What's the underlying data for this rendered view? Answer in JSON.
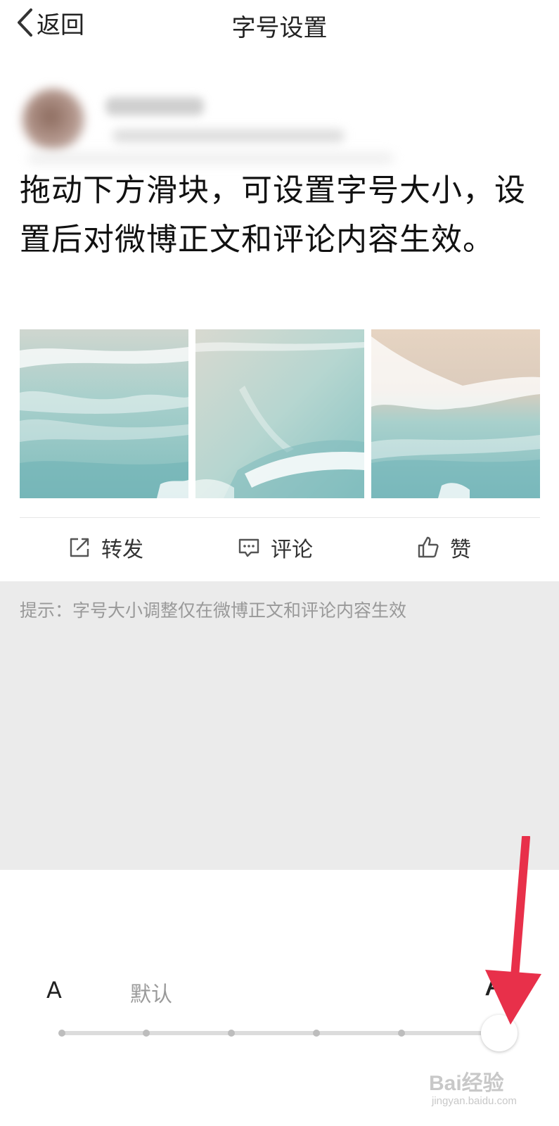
{
  "nav": {
    "back_label": "返回",
    "title": "字号设置"
  },
  "post": {
    "text": "拖动下方滑块，可设置字号大小，设置后对微博正文和评论内容生效。",
    "images": [
      {
        "icon": "beach-aerial-photo-1"
      },
      {
        "icon": "beach-aerial-photo-2"
      },
      {
        "icon": "beach-aerial-photo-3"
      }
    ],
    "actions": {
      "repost": "转发",
      "comment": "评论",
      "like": "赞"
    }
  },
  "tip": {
    "text": "提示：字号大小调整仅在微博正文和评论内容生效"
  },
  "slider": {
    "small_label": "A",
    "default_label": "默认",
    "large_label": "A",
    "steps": 6,
    "selected_step": 6
  },
  "colors": {
    "annotation_arrow": "#e8304a",
    "tip_background": "#ebebeb",
    "tip_text": "#999999"
  },
  "watermark": {
    "main": "Bai经验",
    "sub": "jingyan.baidu.com"
  }
}
